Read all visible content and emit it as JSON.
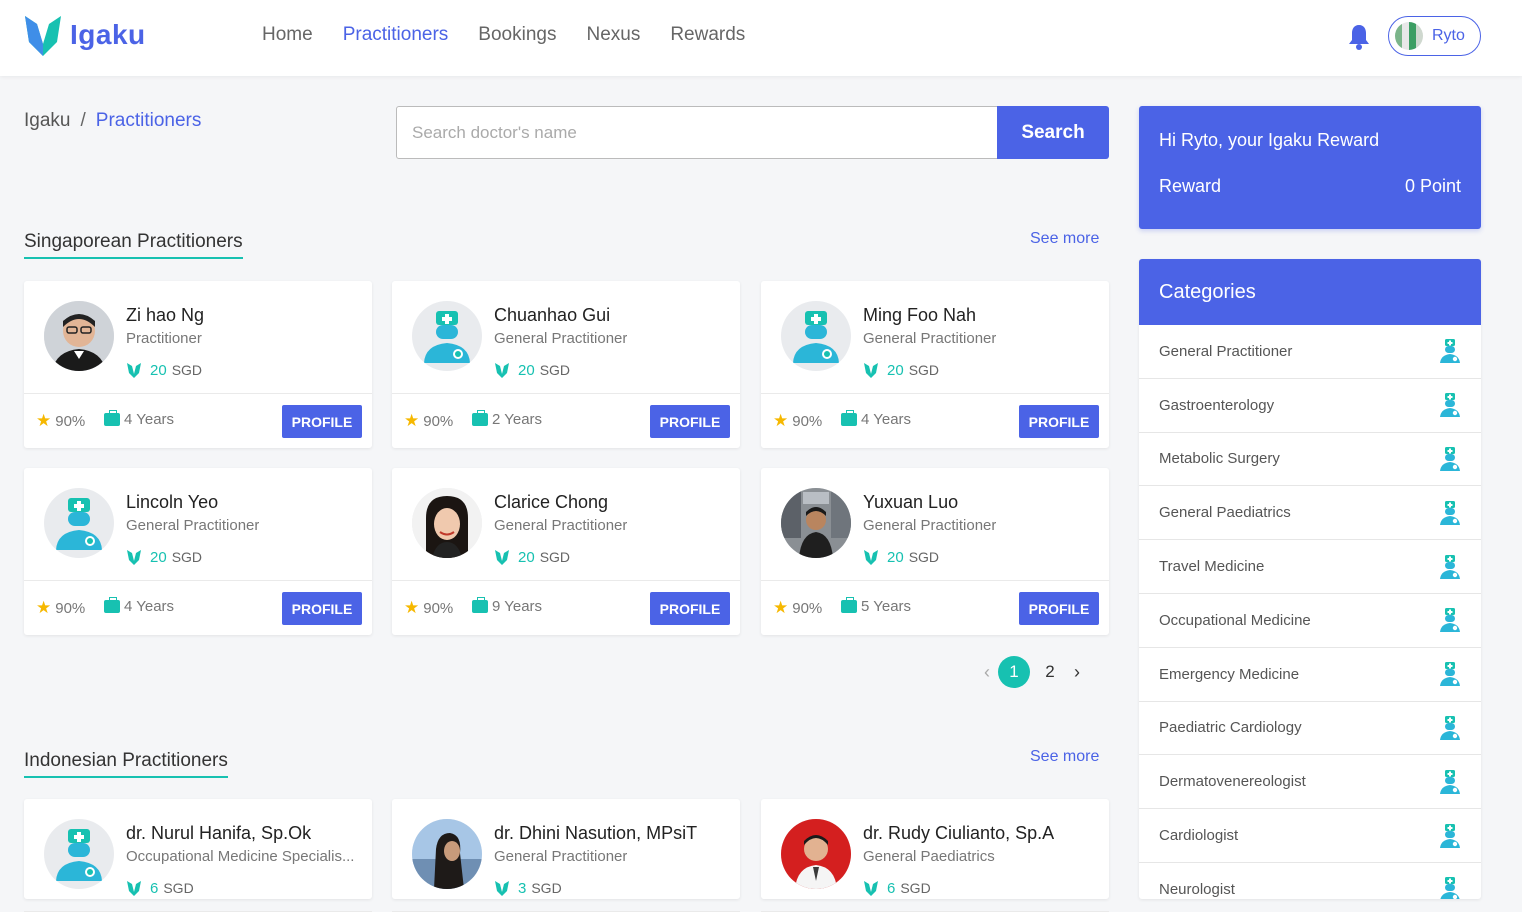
{
  "app": {
    "name": "Igaku",
    "brand_color": "#4b63e6",
    "accent_color": "#17c1b1"
  },
  "nav": {
    "items": [
      "Home",
      "Practitioners",
      "Bookings",
      "Nexus",
      "Rewards"
    ],
    "active": "Practitioners"
  },
  "user": {
    "name": "Ryto",
    "notification_icon": "bell-icon"
  },
  "breadcrumb": {
    "root": "Igaku",
    "separator": "/",
    "current": "Practitioners"
  },
  "search": {
    "placeholder": "Search doctor's name",
    "button_label": "Search"
  },
  "sections": [
    {
      "title": "Singaporean Practitioners",
      "see_more": "See more",
      "doctors": [
        {
          "name": "Zi hao Ng",
          "specialty": "Practitioner",
          "price": "20",
          "currency": "SGD",
          "rating": "90%",
          "experience": "4 Years",
          "avatar": "photo-man-glasses"
        },
        {
          "name": "Chuanhao Gui",
          "specialty": "General Practitioner",
          "price": "20",
          "currency": "SGD",
          "rating": "90%",
          "experience": "2 Years",
          "avatar": "doctor-placeholder-icon"
        },
        {
          "name": "Ming Foo Nah",
          "specialty": "General Practitioner",
          "price": "20",
          "currency": "SGD",
          "rating": "90%",
          "experience": "4 Years",
          "avatar": "doctor-placeholder-icon"
        },
        {
          "name": "Lincoln Yeo",
          "specialty": "General Practitioner",
          "price": "20",
          "currency": "SGD",
          "rating": "90%",
          "experience": "4 Years",
          "avatar": "doctor-placeholder-icon"
        },
        {
          "name": "Clarice Chong",
          "specialty": "General Practitioner",
          "price": "20",
          "currency": "SGD",
          "rating": "90%",
          "experience": "9 Years",
          "avatar": "photo-woman"
        },
        {
          "name": "Yuxuan Luo",
          "specialty": "General Practitioner",
          "price": "20",
          "currency": "SGD",
          "rating": "90%",
          "experience": "5 Years",
          "avatar": "photo-man-outdoor"
        }
      ],
      "profile_label": "PROFILE",
      "pagination": {
        "pages": [
          "1",
          "2"
        ],
        "current": "1"
      }
    },
    {
      "title": "Indonesian Practitioners",
      "see_more": "See more",
      "doctors": [
        {
          "name": "dr. Nurul Hanifa, Sp.Ok",
          "specialty": "Occupational Medicine Specialis...",
          "price": "6",
          "currency": "SGD",
          "avatar": "doctor-placeholder-icon"
        },
        {
          "name": "dr. Dhini Nasution, MPsiT",
          "specialty": "General Practitioner",
          "price": "3",
          "currency": "SGD",
          "avatar": "photo-woman-sky"
        },
        {
          "name": "dr. Rudy Ciulianto, Sp.A",
          "specialty": "General Paediatrics",
          "price": "6",
          "currency": "SGD",
          "avatar": "photo-man-red"
        }
      ]
    }
  ],
  "reward": {
    "title": "Hi Ryto, your Igaku Reward",
    "label": "Reward",
    "points": "0 Point"
  },
  "categories": {
    "title": "Categories",
    "items": [
      "General Practitioner",
      "Gastroenterology",
      "Metabolic Surgery",
      "General Paediatrics",
      "Travel Medicine",
      "Occupational Medicine",
      "Emergency Medicine",
      "Paediatric Cardiology",
      "Dermatovenereologist",
      "Cardiologist",
      "Neurologist"
    ]
  }
}
